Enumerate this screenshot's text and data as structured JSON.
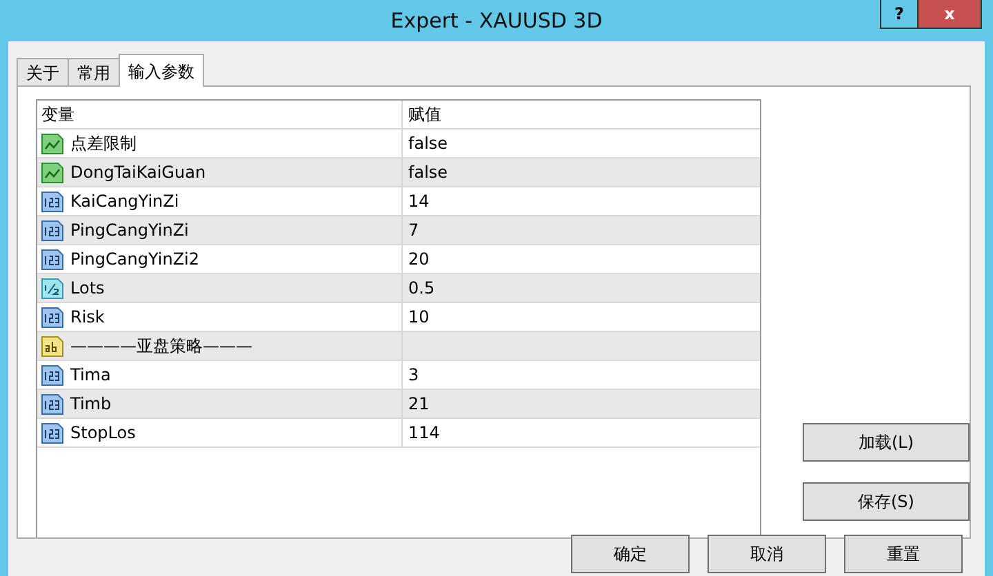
{
  "window": {
    "title": "Expert - XAUUSD 3D",
    "help_button": "?",
    "close_button": "x"
  },
  "tabs": [
    {
      "label": "关于",
      "selected": false
    },
    {
      "label": "常用",
      "selected": false
    },
    {
      "label": "输入参数",
      "selected": true
    }
  ],
  "table": {
    "columns": [
      "变量",
      "赋值"
    ],
    "rows": [
      {
        "kind": "bool",
        "name": "点差限制",
        "value": "false"
      },
      {
        "kind": "bool",
        "name": "DongTaiKaiGuan",
        "value": "false"
      },
      {
        "kind": "int",
        "name": "KaiCangYinZi",
        "value": "14"
      },
      {
        "kind": "int",
        "name": "PingCangYinZi",
        "value": "7"
      },
      {
        "kind": "int",
        "name": "PingCangYinZi2",
        "value": "20"
      },
      {
        "kind": "double",
        "name": "Lots",
        "value": "0.5"
      },
      {
        "kind": "int",
        "name": "Risk",
        "value": "10"
      },
      {
        "kind": "string",
        "name": "————亚盘策略———"
      },
      {
        "kind": "int",
        "name": "Tima",
        "value": "3"
      },
      {
        "kind": "int",
        "name": "Timb",
        "value": "21"
      },
      {
        "kind": "int",
        "name": "StopLos",
        "value": "114"
      }
    ]
  },
  "side_buttons": [
    "加载(L)",
    "保存(S)"
  ],
  "buttons": [
    "确定",
    "取消",
    "重置"
  ]
}
